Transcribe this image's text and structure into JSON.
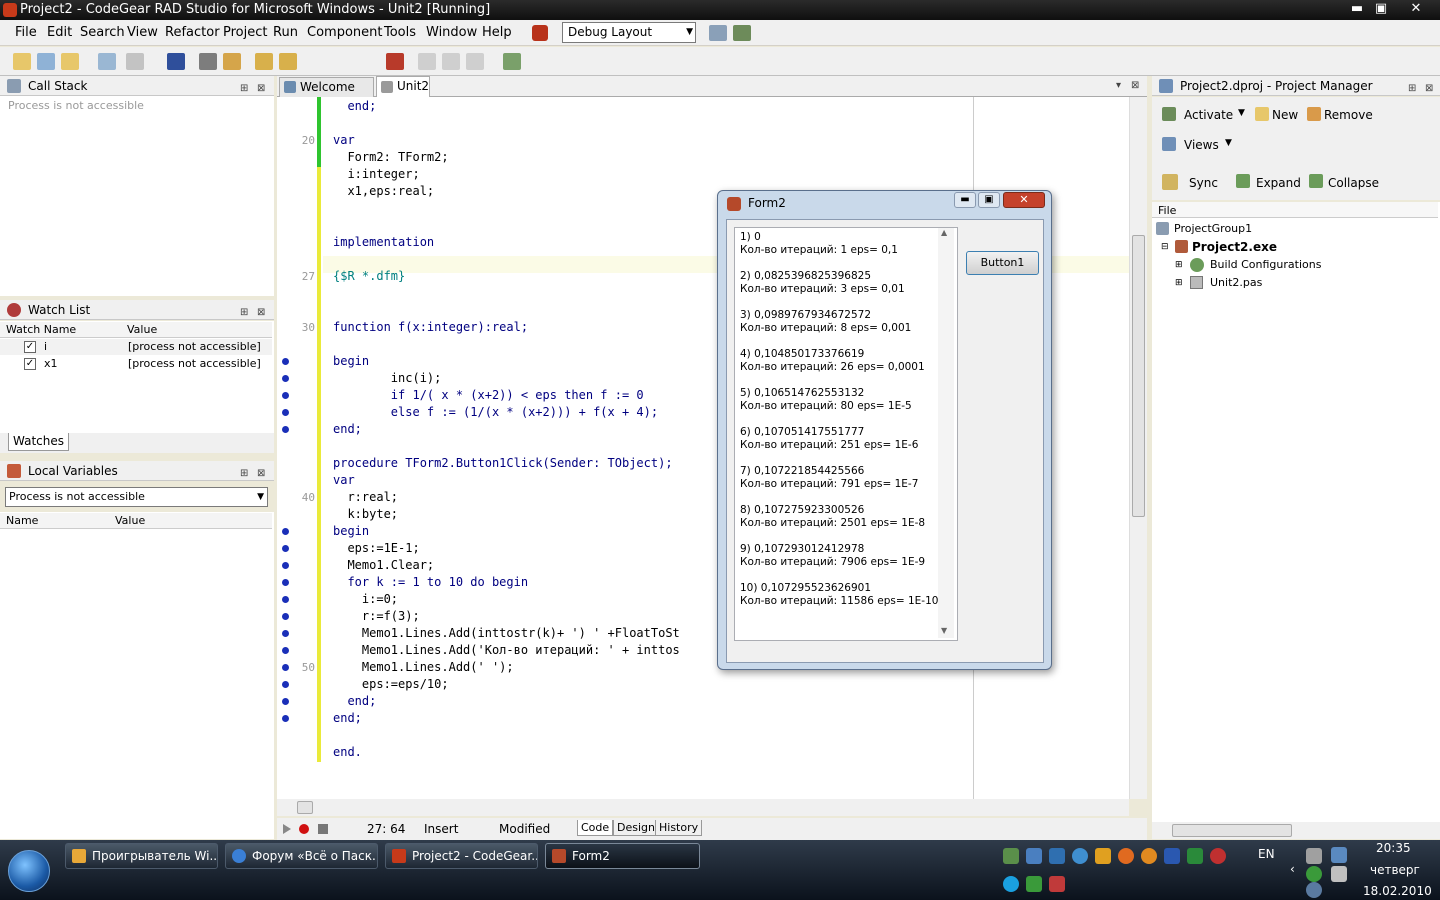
{
  "window": {
    "title": "Project2 - CodeGear RAD Studio for Microsoft Windows - Unit2 [Running]",
    "min": "▬",
    "max": "▣",
    "close": "✕"
  },
  "menu": [
    "File",
    "Edit",
    "Search",
    "View",
    "Refactor",
    "Project",
    "Run",
    "Component",
    "Tools",
    "Window",
    "Help"
  ],
  "layout_combo": "Debug Layout",
  "call_stack": {
    "title": "Call Stack",
    "message": "Process is not accessible",
    "btn_pin": "⊞",
    "btn_close": "⊠"
  },
  "watch_list": {
    "title": "Watch List",
    "col_name": "Watch Name",
    "col_value": "Value",
    "rows": [
      {
        "name": "i",
        "value": "[process not accessible]"
      },
      {
        "name": "x1",
        "value": "[process not accessible]"
      }
    ],
    "tab": "Watches"
  },
  "local_vars": {
    "title": "Local Variables",
    "combo": "Process is not accessible",
    "col_name": "Name",
    "col_value": "Value"
  },
  "editor_tabs": {
    "welcome": "Welcome Page",
    "unit": "Unit2"
  },
  "code": [
    {
      "n": "",
      "t": "  end;",
      "bp": false
    },
    {
      "n": "",
      "t": "",
      "bp": false
    },
    {
      "n": "20",
      "t": "var",
      "bp": false
    },
    {
      "n": "",
      "t": "  Form2: TForm2;",
      "bp": false
    },
    {
      "n": "",
      "t": "  i:integer;",
      "bp": false
    },
    {
      "n": "",
      "t": "  x1,eps:real;",
      "bp": false
    },
    {
      "n": "",
      "t": "",
      "bp": false
    },
    {
      "n": "",
      "t": "",
      "bp": false
    },
    {
      "n": "",
      "t": "implementation",
      "bp": false
    },
    {
      "n": "",
      "t": "",
      "bp": false
    },
    {
      "n": "27",
      "t": "{$R *.dfm}",
      "bp": false
    },
    {
      "n": "",
      "t": "",
      "bp": false
    },
    {
      "n": "",
      "t": "",
      "bp": false
    },
    {
      "n": "30",
      "t": "function f(x:integer):real;",
      "bp": false
    },
    {
      "n": "",
      "t": "",
      "bp": false
    },
    {
      "n": "",
      "t": "begin",
      "bp": true
    },
    {
      "n": "",
      "t": "        inc(i);",
      "bp": true
    },
    {
      "n": "",
      "t": "        if 1/( x * (x+2)) < eps then f := 0",
      "bp": true
    },
    {
      "n": "",
      "t": "        else f := (1/(x * (x+2))) + f(x + 4);",
      "bp": true
    },
    {
      "n": "",
      "t": "end;",
      "bp": true
    },
    {
      "n": "",
      "t": "",
      "bp": false
    },
    {
      "n": "",
      "t": "procedure TForm2.Button1Click(Sender: TObject);",
      "bp": false
    },
    {
      "n": "",
      "t": "var",
      "bp": false
    },
    {
      "n": "40",
      "t": "  r:real;",
      "bp": false
    },
    {
      "n": "",
      "t": "  k:byte;",
      "bp": false
    },
    {
      "n": "",
      "t": "begin",
      "bp": true
    },
    {
      "n": "",
      "t": "  eps:=1E-1;",
      "bp": true
    },
    {
      "n": "",
      "t": "  Memo1.Clear;",
      "bp": true
    },
    {
      "n": "",
      "t": "  for k := 1 to 10 do begin",
      "bp": true
    },
    {
      "n": "",
      "t": "    i:=0;",
      "bp": true
    },
    {
      "n": "",
      "t": "    r:=f(3);",
      "bp": true
    },
    {
      "n": "",
      "t": "    Memo1.Lines.Add(inttostr(k)+ ') ' +FloatToSt",
      "bp": true
    },
    {
      "n": "",
      "t": "    Memo1.Lines.Add('Кол-во итераций: ' + inttos",
      "bp": true
    },
    {
      "n": "50",
      "t": "    Memo1.Lines.Add(' ');",
      "bp": true
    },
    {
      "n": "",
      "t": "    eps:=eps/10;",
      "bp": true
    },
    {
      "n": "",
      "t": "  end;",
      "bp": true
    },
    {
      "n": "",
      "t": "end;",
      "bp": true
    },
    {
      "n": "",
      "t": "",
      "bp": false
    },
    {
      "n": "",
      "t": "end.",
      "bp": false
    }
  ],
  "form2": {
    "title": "Form2",
    "button": "Button1",
    "memo": [
      "1) 0",
      "Кол-во итераций: 1 eps= 0,1",
      "",
      "2) 0,0825396825396825",
      "Кол-во итераций: 3 eps= 0,01",
      "",
      "3) 0,0989767934672572",
      "Кол-во итераций: 8 eps= 0,001",
      "",
      "4) 0,104850173376619",
      "Кол-во итераций: 26 eps= 0,0001",
      "",
      "5) 0,106514762553132",
      "Кол-во итераций: 80 eps= 1E-5",
      "",
      "6) 0,107051417551777",
      "Кол-во итераций: 251 eps= 1E-6",
      "",
      "7) 0,107221854425566",
      "Кол-во итераций: 791 eps= 1E-7",
      "",
      "8) 0,107275923300526",
      "Кол-во итераций: 2501 eps= 1E-8",
      "",
      "9) 0,107293012412978",
      "Кол-во итераций: 7906 eps= 1E-9",
      "",
      "10) 0,107295523626901",
      "Кол-во итераций: 11586 eps= 1E-10"
    ]
  },
  "project_manager": {
    "title": "Project2.dproj - Project Manager",
    "activate": "Activate",
    "new": "New",
    "remove": "Remove",
    "views": "Views",
    "sync": "Sync",
    "expand": "Expand",
    "collapse": "Collapse",
    "col_file": "File",
    "tree": {
      "group": "ProjectGroup1",
      "exe": "Project2.exe",
      "build": "Build Configurations",
      "unit": "Unit2.pas"
    }
  },
  "status": {
    "pos": "27: 64",
    "mode": "Insert",
    "modified": "Modified",
    "tab_code": "Code",
    "tab_design": "Design",
    "tab_history": "History"
  },
  "taskbar": {
    "items": [
      "Проигрыватель Wi...",
      "Форум «Всё о Паск...",
      "Project2 - CodeGear...",
      "Form2"
    ],
    "lang": "EN",
    "time": "20:35",
    "day": "четверг",
    "date": "18.02.2010"
  }
}
